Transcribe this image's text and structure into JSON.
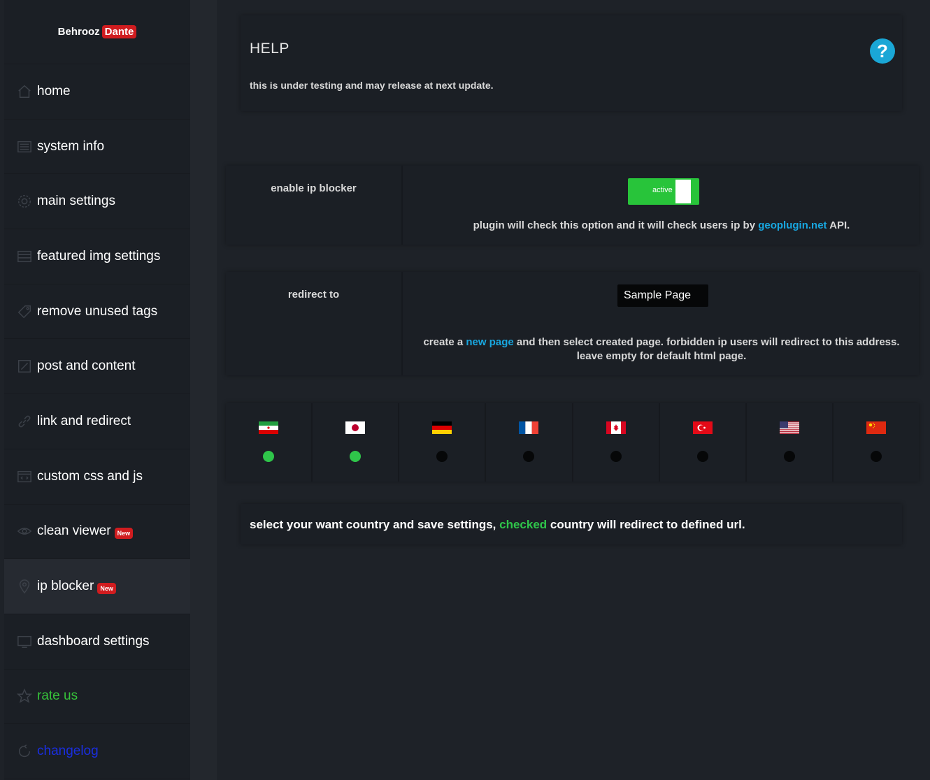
{
  "brand": {
    "name": "Behrooz",
    "tag": "Dante"
  },
  "sidebar": {
    "items": [
      {
        "label": "home",
        "icon": "home-icon"
      },
      {
        "label": "system info",
        "icon": "list-icon"
      },
      {
        "label": "main settings",
        "icon": "gear-icon"
      },
      {
        "label": "featured img settings",
        "icon": "image-icon"
      },
      {
        "label": "remove unused tags",
        "icon": "tag-icon"
      },
      {
        "label": "post and content",
        "icon": "edit-icon"
      },
      {
        "label": "link and redirect",
        "icon": "link-icon"
      },
      {
        "label": "custom css and js",
        "icon": "code-icon"
      },
      {
        "label": "clean viewer",
        "icon": "eye-icon",
        "badge": "New"
      },
      {
        "label": "ip blocker",
        "icon": "pin-icon",
        "badge": "New",
        "active": true
      },
      {
        "label": "dashboard settings",
        "icon": "monitor-icon"
      },
      {
        "label": "rate us",
        "icon": "star-icon",
        "color": "#36c23a"
      },
      {
        "label": "changelog",
        "icon": "refresh-icon",
        "color": "#1a2ee0"
      }
    ]
  },
  "help": {
    "title": "HELP",
    "text": "this is under testing and may release at next update.",
    "icon_glyph": "?"
  },
  "ip_blocker": {
    "label": "enable ip blocker",
    "toggle_label": "active",
    "toggle_on": true,
    "note_pre": "plugin will check this option and it will check users ip by",
    "note_link": "geoplugin.net",
    "note_post": "API."
  },
  "redirect": {
    "label": "redirect to",
    "selected_page": "Sample Page",
    "note_pre": "create a",
    "note_link": "new page",
    "note_post": "and then select created page. forbidden ip users will redirect to this address.",
    "note_line2": "leave empty for default html page."
  },
  "countries": [
    {
      "flag": "iran-flag",
      "checked": true
    },
    {
      "flag": "japan-flag",
      "checked": true
    },
    {
      "flag": "germany-flag",
      "checked": false
    },
    {
      "flag": "france-flag",
      "checked": false
    },
    {
      "flag": "canada-flag",
      "checked": false
    },
    {
      "flag": "turkey-flag",
      "checked": false
    },
    {
      "flag": "usa-flag",
      "checked": false
    },
    {
      "flag": "china-flag",
      "checked": false
    }
  ],
  "footer_note": {
    "pre": "select your want country and save settings,",
    "highlight": "checked",
    "post": "country will redirect to defined url."
  },
  "colors": {
    "accent_green": "#2fc54a",
    "link_blue": "#18a7e0",
    "badge_red": "#d01c1f",
    "help_icon": "#1aa7d6"
  }
}
